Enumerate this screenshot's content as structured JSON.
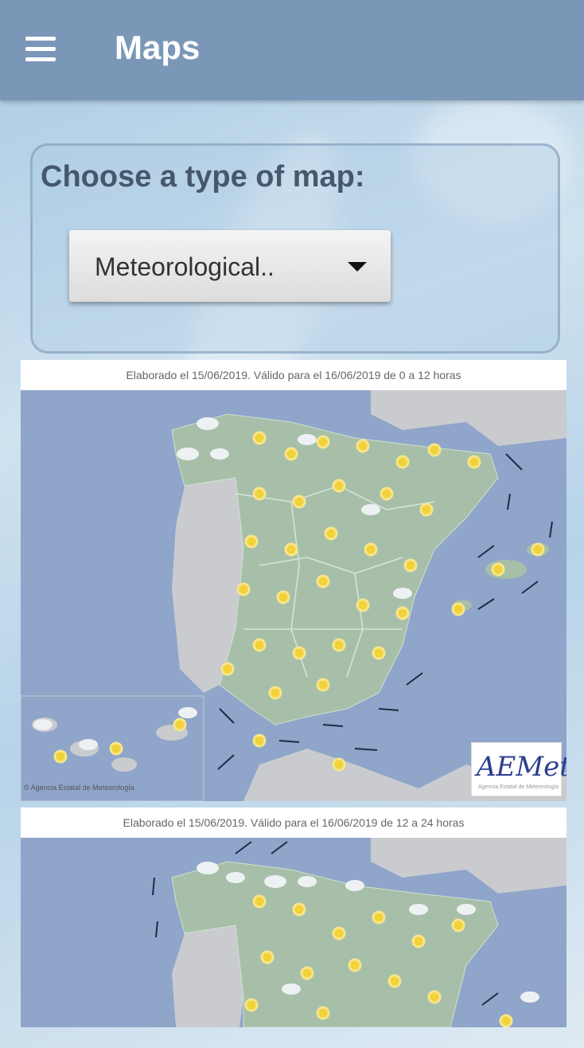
{
  "app_bar": {
    "title": "Maps",
    "menu_icon": "hamburger-menu-icon"
  },
  "chooser": {
    "label": "Choose a type of map:",
    "selected_value": "Meteorological..",
    "dropdown_icon": "triangle-down-icon"
  },
  "maps": [
    {
      "caption": "Elaborado el 15/06/2019. Válido para el 16/06/2019 de 0 a 12 horas",
      "logo_text": "AEMet",
      "logo_subtitle": "Agencia Estatal de Meteorología",
      "copyright": "© Agencia Estatal de Meteorología"
    },
    {
      "caption": "Elaborado el 15/06/2019. Válido para el 16/06/2019 de 12 a 24 horas"
    }
  ],
  "colors": {
    "app_bar": "#7b97b8",
    "sea": "#8fa5c9",
    "spain_land": "#a7bfa9",
    "foreign_land": "#c9cbcf",
    "sun": "#f2d23a"
  }
}
